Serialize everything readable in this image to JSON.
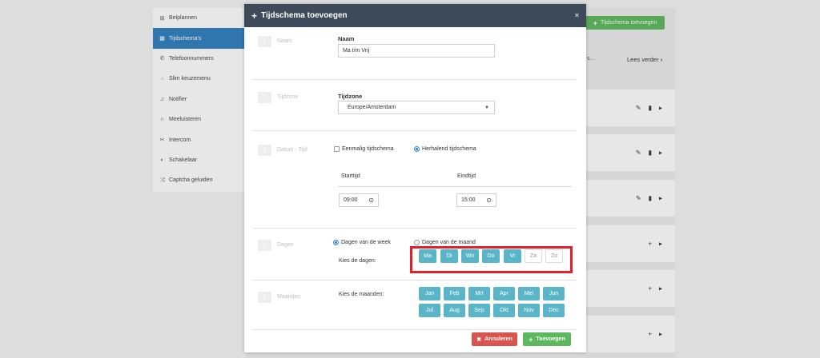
{
  "sidebar": {
    "items": [
      {
        "icon": "sitemap-icon",
        "label": "Belplannen"
      },
      {
        "icon": "calendar-icon",
        "label": "Tijdschema's"
      },
      {
        "icon": "phone-icon",
        "label": "Telefoonnummers"
      },
      {
        "icon": "keypad-icon",
        "label": "Slim keuzemenu"
      },
      {
        "icon": "bell-icon",
        "label": "Notifier"
      },
      {
        "icon": "headset-icon",
        "label": "Meeluisteren"
      },
      {
        "icon": "intercom-icon",
        "label": "Intercom"
      },
      {
        "icon": "toggle-icon",
        "label": "Schakelaar"
      },
      {
        "icon": "shuffle-icon",
        "label": "Captcha geluiden"
      }
    ]
  },
  "background": {
    "add_button": "Tijdschema toevoegen",
    "read_more": "Lees verder",
    "header_dots": "s..."
  },
  "modal": {
    "title": "Tijdschema toevoegen",
    "close": "×",
    "steps": [
      {
        "num": "1",
        "label": "Naam"
      },
      {
        "num": "2",
        "label": "Tijdzone"
      },
      {
        "num": "3",
        "label": "Datum - Tijd"
      },
      {
        "num": "4",
        "label": "Dagen"
      },
      {
        "num": "5",
        "label": "Maanden"
      }
    ],
    "name": {
      "label": "Naam",
      "value": "Ma t/m Vrij"
    },
    "timezone": {
      "label": "Tijdzone",
      "value": "Europe/Amsterdam"
    },
    "schedule_type": {
      "once": "Eenmalig tijdschema",
      "recurring": "Herhalend tijdschema",
      "selected": "recurring"
    },
    "start_time": {
      "label": "Starttijd",
      "value": "09:00"
    },
    "end_time": {
      "label": "Eindtijd",
      "value": "15:00"
    },
    "days_mode": {
      "week": "Dagen van de week",
      "month": "Dagen van de maand",
      "selected": "week"
    },
    "days_label": "Kies de dagen:",
    "days": [
      {
        "label": "Ma",
        "selected": true
      },
      {
        "label": "Di",
        "selected": true
      },
      {
        "label": "Wo",
        "selected": true
      },
      {
        "label": "Do",
        "selected": true
      },
      {
        "label": "Vr",
        "selected": true
      },
      {
        "label": "Za",
        "selected": false
      },
      {
        "label": "Zo",
        "selected": false
      }
    ],
    "months_label": "Kies de maanden:",
    "months": [
      "Jan",
      "Feb",
      "Mrt",
      "Apr",
      "Mei",
      "Jun",
      "Jul",
      "Aug",
      "Sep",
      "Okt",
      "Nov",
      "Dec"
    ],
    "cancel": "Annuleren",
    "submit": "Toevoegen"
  },
  "colors": {
    "header": "#3d4a5a",
    "day_selected": "#5bb5c9",
    "highlight": "#e0202a",
    "cancel": "#d9534f",
    "submit": "#5cb85c",
    "sidebar_active": "#2e7fbf"
  }
}
